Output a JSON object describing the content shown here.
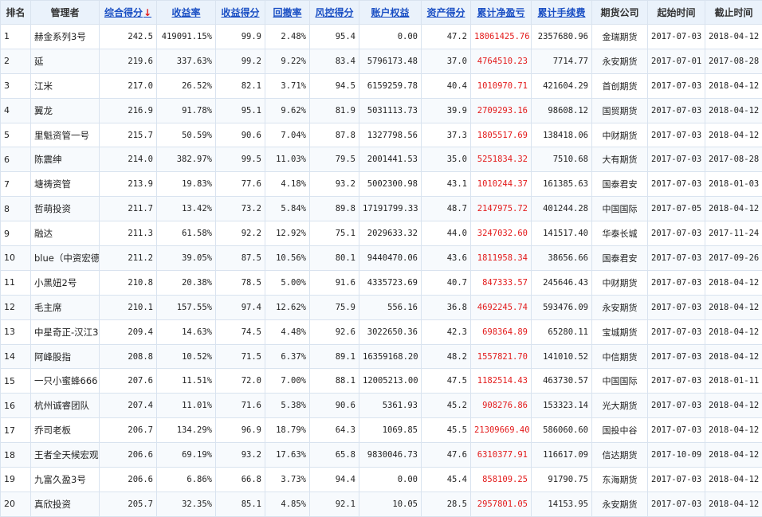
{
  "headers": {
    "rank": "排名",
    "manager": "管理者",
    "total_score": "综合得分",
    "sort_arrow": "↓",
    "return_rate": "收益率",
    "return_score": "收益得分",
    "drawdown": "回撤率",
    "risk_score": "风控得分",
    "equity": "账户权益",
    "asset_score": "资产得分",
    "cum_pnl": "累计净盈亏",
    "cum_fee": "累计手续费",
    "broker": "期货公司",
    "start_date": "起始时间",
    "end_date": "截止时间"
  },
  "colors": {
    "header_bg": "#eaf2fb",
    "link": "#1a4fc4",
    "accent_red": "#e31b1b",
    "border": "#d9e3ef"
  },
  "rows": [
    {
      "rank": "1",
      "manager": "赫金系列3号",
      "total": "242.5",
      "ret": "419091.15%",
      "ret_score": "99.9",
      "dd": "2.48%",
      "risk": "95.4",
      "equity": "0.00",
      "asset": "47.2",
      "pnl": "18061425.76",
      "fee": "2357680.96",
      "broker": "金瑞期货",
      "start": "2017-07-03",
      "end": "2018-04-12"
    },
    {
      "rank": "2",
      "manager": "延",
      "total": "219.6",
      "ret": "337.63%",
      "ret_score": "99.2",
      "dd": "9.22%",
      "risk": "83.4",
      "equity": "5796173.48",
      "asset": "37.0",
      "pnl": "4764510.23",
      "fee": "7714.77",
      "broker": "永安期货",
      "start": "2017-07-01",
      "end": "2017-08-28"
    },
    {
      "rank": "3",
      "manager": "江米",
      "total": "217.0",
      "ret": "26.52%",
      "ret_score": "82.1",
      "dd": "3.71%",
      "risk": "94.5",
      "equity": "6159259.78",
      "asset": "40.4",
      "pnl": "1010970.71",
      "fee": "421604.29",
      "broker": "首创期货",
      "start": "2017-07-03",
      "end": "2018-04-12"
    },
    {
      "rank": "4",
      "manager": "翼龙",
      "total": "216.9",
      "ret": "91.78%",
      "ret_score": "95.1",
      "dd": "9.62%",
      "risk": "81.9",
      "equity": "5031113.73",
      "asset": "39.9",
      "pnl": "2709293.16",
      "fee": "98608.12",
      "broker": "国贸期货",
      "start": "2017-07-03",
      "end": "2018-04-12"
    },
    {
      "rank": "5",
      "manager": "里魁资管一号",
      "total": "215.7",
      "ret": "50.59%",
      "ret_score": "90.6",
      "dd": "7.04%",
      "risk": "87.8",
      "equity": "1327798.56",
      "asset": "37.3",
      "pnl": "1805517.69",
      "fee": "138418.06",
      "broker": "中财期货",
      "start": "2017-07-03",
      "end": "2018-04-12"
    },
    {
      "rank": "6",
      "manager": "陈震绅",
      "total": "214.0",
      "ret": "382.97%",
      "ret_score": "99.5",
      "dd": "11.03%",
      "risk": "79.5",
      "equity": "2001441.53",
      "asset": "35.0",
      "pnl": "5251834.32",
      "fee": "7510.68",
      "broker": "大有期货",
      "start": "2017-07-03",
      "end": "2017-08-28"
    },
    {
      "rank": "7",
      "manager": "塘祷资管",
      "total": "213.9",
      "ret": "19.83%",
      "ret_score": "77.6",
      "dd": "4.18%",
      "risk": "93.2",
      "equity": "5002300.98",
      "asset": "43.1",
      "pnl": "1010244.37",
      "fee": "161385.63",
      "broker": "国泰君安",
      "start": "2017-07-03",
      "end": "2018-01-03"
    },
    {
      "rank": "8",
      "manager": "哲萌投资",
      "total": "211.7",
      "ret": "13.42%",
      "ret_score": "73.2",
      "dd": "5.84%",
      "risk": "89.8",
      "equity": "17191799.33",
      "asset": "48.7",
      "pnl": "2147975.72",
      "fee": "401244.28",
      "broker": "中国国际",
      "start": "2017-07-05",
      "end": "2018-04-12"
    },
    {
      "rank": "9",
      "manager": "融达",
      "total": "211.3",
      "ret": "61.58%",
      "ret_score": "92.2",
      "dd": "12.92%",
      "risk": "75.1",
      "equity": "2029633.32",
      "asset": "44.0",
      "pnl": "3247032.60",
      "fee": "141517.40",
      "broker": "华泰长城",
      "start": "2017-07-03",
      "end": "2017-11-24"
    },
    {
      "rank": "10",
      "manager": "blue（中资宏德",
      "total": "211.2",
      "ret": "39.05%",
      "ret_score": "87.5",
      "dd": "10.56%",
      "risk": "80.1",
      "equity": "9440470.06",
      "asset": "43.6",
      "pnl": "1811958.34",
      "fee": "38656.66",
      "broker": "国泰君安",
      "start": "2017-07-03",
      "end": "2017-09-26"
    },
    {
      "rank": "11",
      "manager": "小黑妞2号",
      "total": "210.8",
      "ret": "20.38%",
      "ret_score": "78.5",
      "dd": "5.00%",
      "risk": "91.6",
      "equity": "4335723.69",
      "asset": "40.7",
      "pnl": "847333.57",
      "fee": "245646.43",
      "broker": "中财期货",
      "start": "2017-07-03",
      "end": "2018-04-12"
    },
    {
      "rank": "12",
      "manager": "毛主席",
      "total": "210.1",
      "ret": "157.55%",
      "ret_score": "97.4",
      "dd": "12.62%",
      "risk": "75.9",
      "equity": "556.16",
      "asset": "36.8",
      "pnl": "4692245.74",
      "fee": "593476.09",
      "broker": "永安期货",
      "start": "2017-07-03",
      "end": "2018-04-12"
    },
    {
      "rank": "13",
      "manager": "中星奇正-汉江3",
      "total": "209.4",
      "ret": "14.63%",
      "ret_score": "74.5",
      "dd": "4.48%",
      "risk": "92.6",
      "equity": "3022650.36",
      "asset": "42.3",
      "pnl": "698364.89",
      "fee": "65280.11",
      "broker": "宝城期货",
      "start": "2017-07-03",
      "end": "2018-04-12"
    },
    {
      "rank": "14",
      "manager": "阿峰股指",
      "total": "208.8",
      "ret": "10.52%",
      "ret_score": "71.5",
      "dd": "6.37%",
      "risk": "89.1",
      "equity": "16359168.20",
      "asset": "48.2",
      "pnl": "1557821.70",
      "fee": "141010.52",
      "broker": "中信期货",
      "start": "2017-07-03",
      "end": "2018-04-12"
    },
    {
      "rank": "15",
      "manager": "一只小蜜蜂666",
      "total": "207.6",
      "ret": "11.51%",
      "ret_score": "72.0",
      "dd": "7.00%",
      "risk": "88.1",
      "equity": "12005213.00",
      "asset": "47.5",
      "pnl": "1182514.43",
      "fee": "463730.57",
      "broker": "中国国际",
      "start": "2017-07-03",
      "end": "2018-01-11"
    },
    {
      "rank": "16",
      "manager": "杭州诚睿团队",
      "total": "207.4",
      "ret": "11.01%",
      "ret_score": "71.6",
      "dd": "5.38%",
      "risk": "90.6",
      "equity": "5361.93",
      "asset": "45.2",
      "pnl": "908276.86",
      "fee": "153323.14",
      "broker": "光大期货",
      "start": "2017-07-03",
      "end": "2018-04-12"
    },
    {
      "rank": "17",
      "manager": "乔司老板",
      "total": "206.7",
      "ret": "134.29%",
      "ret_score": "96.9",
      "dd": "18.79%",
      "risk": "64.3",
      "equity": "1069.85",
      "asset": "45.5",
      "pnl": "21309669.40",
      "fee": "586060.60",
      "broker": "国投中谷",
      "start": "2017-07-03",
      "end": "2018-04-12"
    },
    {
      "rank": "18",
      "manager": "王者全天候宏观",
      "total": "206.6",
      "ret": "69.19%",
      "ret_score": "93.2",
      "dd": "17.63%",
      "risk": "65.8",
      "equity": "9830046.73",
      "asset": "47.6",
      "pnl": "6310377.91",
      "fee": "116617.09",
      "broker": "信达期货",
      "start": "2017-10-09",
      "end": "2018-04-12"
    },
    {
      "rank": "19",
      "manager": "九富久盈3号",
      "total": "206.6",
      "ret": "6.86%",
      "ret_score": "66.8",
      "dd": "3.73%",
      "risk": "94.4",
      "equity": "0.00",
      "asset": "45.4",
      "pnl": "858109.25",
      "fee": "91790.75",
      "broker": "东海期货",
      "start": "2017-07-03",
      "end": "2018-04-12"
    },
    {
      "rank": "20",
      "manager": "真欣投资",
      "total": "205.7",
      "ret": "32.35%",
      "ret_score": "85.1",
      "dd": "4.85%",
      "risk": "92.1",
      "equity": "10.05",
      "asset": "28.5",
      "pnl": "2957801.05",
      "fee": "14153.95",
      "broker": "永安期货",
      "start": "2017-07-03",
      "end": "2018-04-12"
    }
  ]
}
